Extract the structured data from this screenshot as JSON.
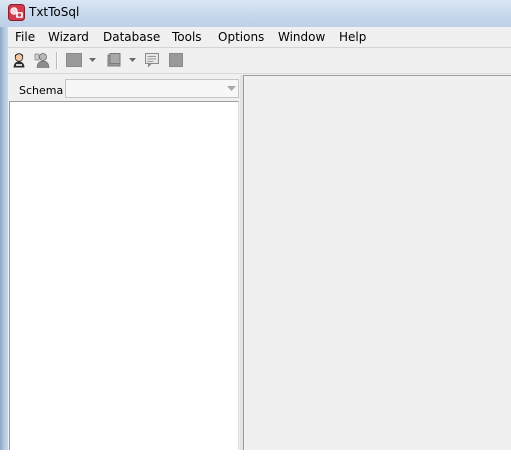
{
  "window": {
    "title": "TxtToSql",
    "app_icon": "txttosql-app-icon"
  },
  "menu": {
    "items": [
      "File",
      "Wizard",
      "Database",
      "Tools",
      "Options",
      "Window",
      "Help"
    ]
  },
  "toolbar": {
    "buttons": [
      {
        "icon": "connect-user-icon",
        "enabled": true
      },
      {
        "icon": "disconnect-icon",
        "enabled": true
      },
      {
        "icon": "table-grey-icon",
        "enabled": false,
        "has_dropdown": true
      },
      {
        "icon": "script-grey-icon",
        "enabled": false,
        "has_dropdown": true
      },
      {
        "icon": "sql-preview-icon",
        "enabled": false
      },
      {
        "icon": "stop-grey-icon",
        "enabled": false
      }
    ]
  },
  "schema_panel": {
    "label": "Schema",
    "selected_value": ""
  },
  "colors": {
    "title_bar": "#c7d8ec",
    "client_background": "#f0f0f0",
    "tree_background": "#ffffff"
  }
}
